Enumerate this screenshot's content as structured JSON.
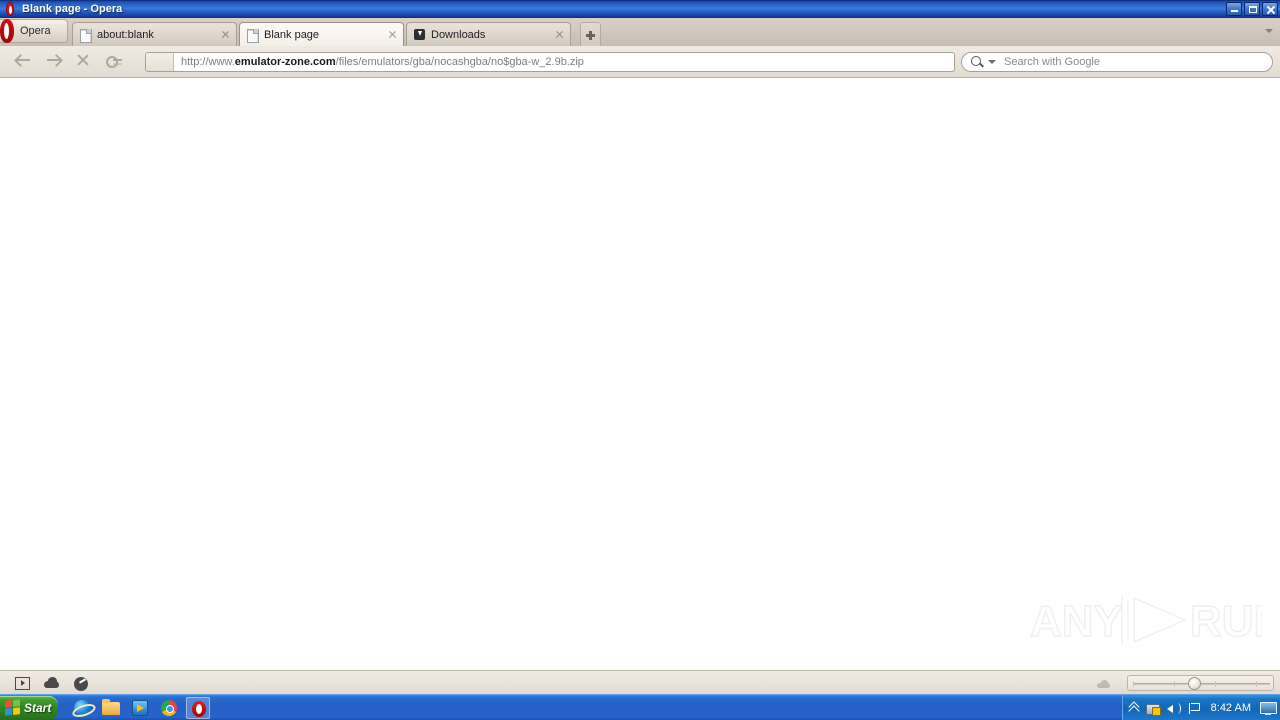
{
  "window": {
    "title": "Blank page - Opera",
    "app_icon": "opera-logo-icon",
    "minimize_label": "Minimize",
    "maximize_label": "Restore",
    "close_label": "Close"
  },
  "tabstrip": {
    "menu_button_label": "Opera",
    "new_tab_label": "New tab",
    "tab_list_label": "Tab list",
    "tabs": [
      {
        "label": "about:blank",
        "favicon": "document-icon",
        "active": false,
        "close_label": "Close tab"
      },
      {
        "label": "Blank page",
        "favicon": "document-icon",
        "active": true,
        "close_label": "Close tab"
      },
      {
        "label": "Downloads",
        "favicon": "downloads-icon",
        "active": false,
        "close_label": "Close tab"
      }
    ]
  },
  "toolbar": {
    "back_label": "Back",
    "forward_label": "Forward",
    "stop_label": "Stop",
    "security_label": "Security badge",
    "address": {
      "prefix": "http://www.",
      "domain": "emulator-zone.com",
      "path": "/files/emulators/gba/nocashgba/no$gba-w_2.9b.zip",
      "full": "http://www.emulator-zone.com/files/emulators/gba/nocashgba/no$gba-w_2.9b.zip"
    },
    "search": {
      "placeholder": "Search with Google",
      "icon": "search-icon",
      "dropdown_label": "Search engine"
    }
  },
  "content": {
    "watermark": "ANY.RUN",
    "watermark_left": "ANY",
    "watermark_right": "RUN"
  },
  "statusbar": {
    "panel_toggle_label": "Show panels",
    "cloud_label": "Opera Turbo",
    "gauge_label": "Page speed",
    "zoom_cloud_label": "Turbo status",
    "zoom_label": "Zoom",
    "zoom_value": "100%"
  },
  "taskbar": {
    "start_label": "Start",
    "quicklaunch": [
      {
        "name": "internet-explorer-icon",
        "label": "Internet Explorer",
        "active": false
      },
      {
        "name": "file-explorer-icon",
        "label": "Windows Explorer",
        "active": false
      },
      {
        "name": "media-player-icon",
        "label": "Windows Media Player",
        "active": false
      },
      {
        "name": "chrome-icon",
        "label": "Google Chrome",
        "active": false
      },
      {
        "name": "opera-icon",
        "label": "Opera",
        "active": true
      }
    ],
    "tray": {
      "expand_label": "Show hidden icons",
      "network_label": "Network",
      "volume_label": "Volume",
      "security_label": "Security Center",
      "clock": "8:42 AM",
      "display_label": "Display"
    }
  },
  "colors": {
    "titlebar_blue": "#1c51b8",
    "taskbar_blue": "#2a6fd4",
    "opera_red": "#d81515",
    "chrome_bg": "#e9e3db",
    "page_bg": "#ffffff"
  }
}
